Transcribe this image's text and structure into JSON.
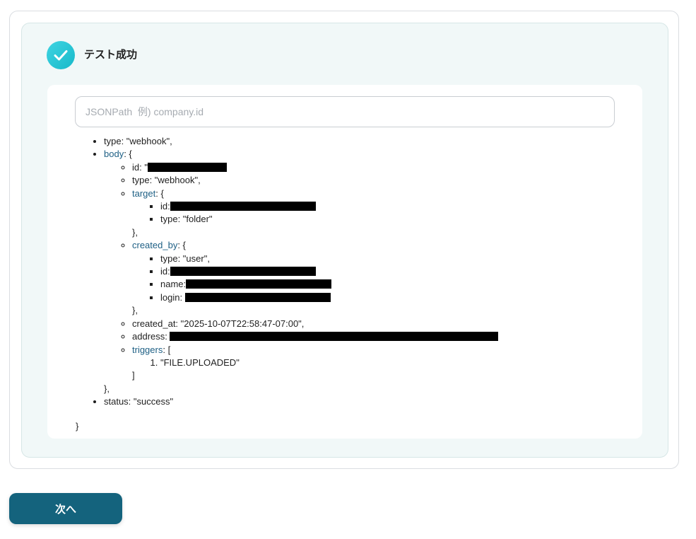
{
  "header": {
    "title": "テスト成功",
    "icon": "check-icon",
    "accent": "#1fc3d2"
  },
  "search": {
    "placeholder": "JSONPath  例) company.id",
    "value": ""
  },
  "json": {
    "type_line": "type: \"webhook\",",
    "body_key": "body",
    "body_open": ": {",
    "id_label": "id: \"",
    "target_key": "target",
    "target_open": ": {",
    "target_id_label": "id:",
    "target_type_line": "type: \"folder\"",
    "target_close": "},",
    "created_by_key": "created_by",
    "created_by_open": ": {",
    "cb_type_line": "type: \"user\",",
    "cb_id_label": "id:",
    "cb_name_label": "name:",
    "cb_login_label": "login: ",
    "created_by_close": "},",
    "created_at_line": "created_at: \"2025-10-07T22:58:47-07:00\",",
    "address_label": "address: ",
    "triggers_key": "triggers",
    "triggers_open": ": [",
    "trigger_1": "\"FILE.UPLOADED\"",
    "triggers_close": "]",
    "body_close": "},",
    "status_line": "status: \"success\"",
    "final_close": "}"
  },
  "footer": {
    "next_label": "次へ",
    "button_color": "#14637d"
  }
}
